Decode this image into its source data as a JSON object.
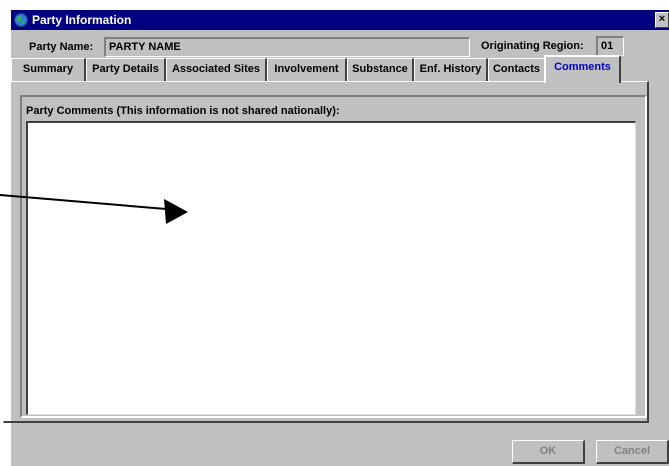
{
  "window": {
    "title": "Party Information",
    "close_glyph": "×"
  },
  "party": {
    "name_label": "Party Name:",
    "name_value": "PARTY NAME"
  },
  "region": {
    "label": "Originating Region:",
    "value": "01"
  },
  "tabs": [
    {
      "label": "Summary"
    },
    {
      "label": "Party Details"
    },
    {
      "label": "Associated Sites"
    },
    {
      "label": "Involvement"
    },
    {
      "label": "Substance"
    },
    {
      "label": "Enf. History"
    },
    {
      "label": "Contacts"
    },
    {
      "label": "Comments",
      "active": true
    }
  ],
  "comments": {
    "group_label": "Party Comments (This information is not shared nationally):",
    "text": ""
  },
  "buttons": {
    "ok_label": "OK",
    "cancel_label": "Cancel"
  },
  "colors": {
    "titlebar": "#000080",
    "face": "#c0c0c0",
    "active_tab_text": "#0000cc"
  },
  "icons": {
    "app": "globe-icon",
    "annotation": "arrow-icon"
  }
}
